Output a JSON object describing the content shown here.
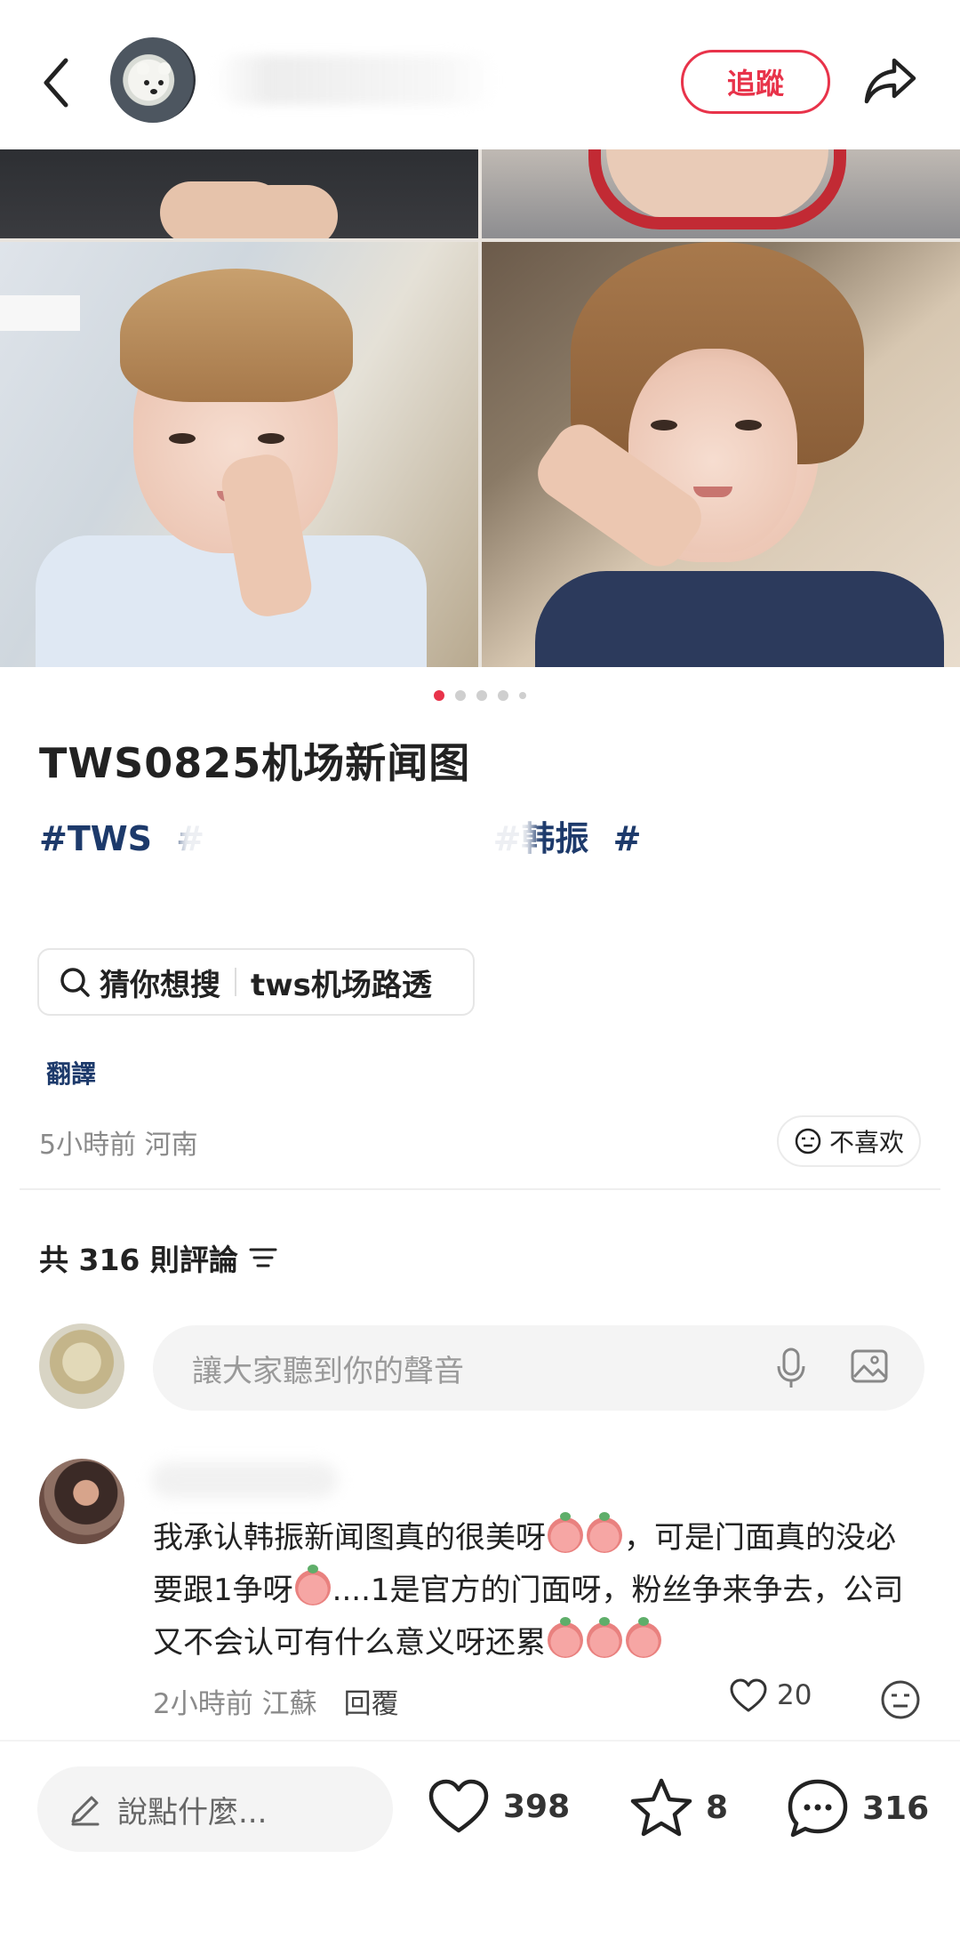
{
  "header": {
    "follow_label": "追蹤"
  },
  "gallery": {
    "total_images": 5,
    "active_index": 0
  },
  "post": {
    "title": "TWS0825机场新闻图",
    "tags": [
      "#TWS",
      "#",
      "#韩振",
      "#"
    ],
    "search_prefix": "猜你想搜",
    "search_query": "tws机场路透",
    "translate_label": "翻譯",
    "meta": "5小時前 河南",
    "dislike_label": "不喜欢"
  },
  "comments": {
    "count_label": "共 316 則評論",
    "input_placeholder": "讓大家聽到你的聲音",
    "items": [
      {
        "text_1": "我承认韩振新闻图真的很美呀",
        "text_2": "，可是门面真的没必要跟1争呀",
        "text_3": "....1是官方的门面呀，粉丝争来争去，公司又不会认可有什么意义呀还累",
        "time_location": "2小時前 江蘇",
        "reply_label": "回覆",
        "likes": "20"
      }
    ]
  },
  "bottom_bar": {
    "say_placeholder": "說點什麼...",
    "likes": "398",
    "stars": "8",
    "comments": "316"
  },
  "colors": {
    "accent": "#e8334a",
    "tag": "#1d3a6b"
  }
}
